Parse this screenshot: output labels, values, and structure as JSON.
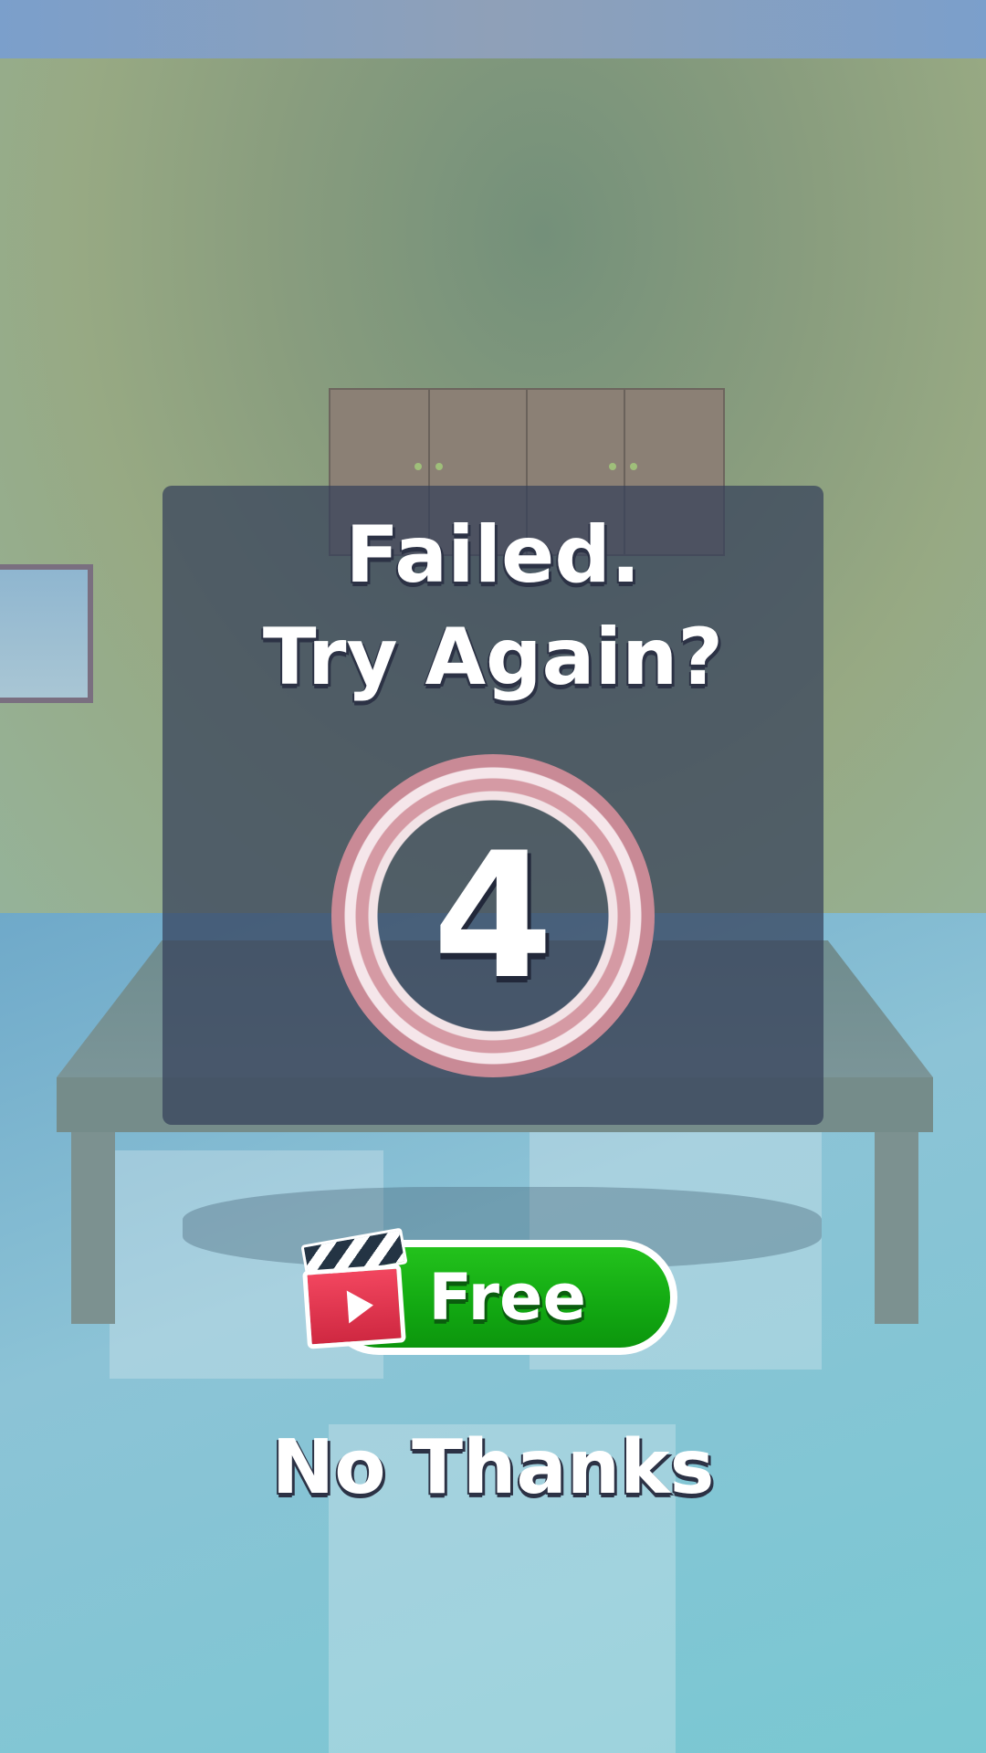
{
  "dialog": {
    "title_line1": "Failed.",
    "title_line2": "Try Again?",
    "countdown": "4"
  },
  "buttons": {
    "free_label": "Free",
    "no_thanks_label": "No Thanks"
  },
  "colors": {
    "panel": "#34405a",
    "free_button": "#16b014",
    "ring": "#d59aa4",
    "clapper": "#e8364f"
  },
  "icons": {
    "free_button_icon": "video-clapper-play-icon"
  }
}
